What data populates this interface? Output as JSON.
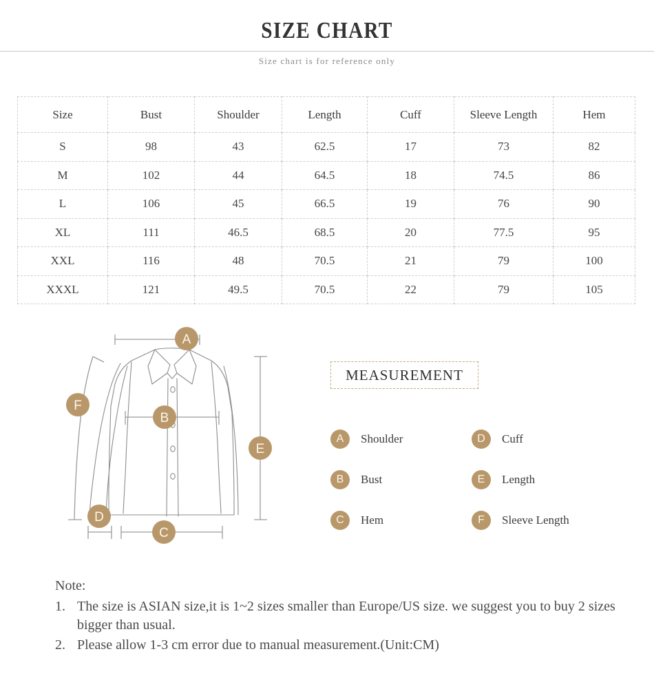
{
  "header": {
    "title": "SIZE CHART",
    "subtitle": "Size chart is for reference only"
  },
  "colors": {
    "badge": "#b8986a",
    "measurement_box_border": "#c0a87e",
    "table_border": "#cfcfcf",
    "text": "#3c3c3c"
  },
  "size_table": {
    "columns": [
      "Size",
      "Bust",
      "Shoulder",
      "Length",
      "Cuff",
      "Sleeve Length",
      "Hem"
    ],
    "rows": [
      [
        "S",
        "98",
        "43",
        "62.5",
        "17",
        "73",
        "82"
      ],
      [
        "M",
        "102",
        "44",
        "64.5",
        "18",
        "74.5",
        "86"
      ],
      [
        "L",
        "106",
        "45",
        "66.5",
        "19",
        "76",
        "90"
      ],
      [
        "XL",
        "111",
        "46.5",
        "68.5",
        "20",
        "77.5",
        "95"
      ],
      [
        "XXL",
        "116",
        "48",
        "70.5",
        "21",
        "79",
        "100"
      ],
      [
        "XXXL",
        "121",
        "49.5",
        "70.5",
        "22",
        "79",
        "105"
      ]
    ]
  },
  "diagram": {
    "markers": [
      "A",
      "B",
      "C",
      "D",
      "E",
      "F"
    ]
  },
  "measurement": {
    "heading": "MEASUREMENT",
    "items": [
      {
        "badge": "A",
        "label": "Shoulder"
      },
      {
        "badge": "D",
        "label": "Cuff"
      },
      {
        "badge": "B",
        "label": "Bust"
      },
      {
        "badge": "E",
        "label": "Length"
      },
      {
        "badge": "C",
        "label": "Hem"
      },
      {
        "badge": "F",
        "label": "Sleeve Length"
      }
    ]
  },
  "note": {
    "title": "Note:",
    "items": [
      {
        "num": "1.",
        "text": "The size is ASIAN size,it is 1~2 sizes smaller than Europe/US size. we suggest you to buy 2 sizes bigger than usual."
      },
      {
        "num": "2.",
        "text": "Please allow 1-3 cm error due to manual measurement.(Unit:CM)"
      }
    ]
  }
}
